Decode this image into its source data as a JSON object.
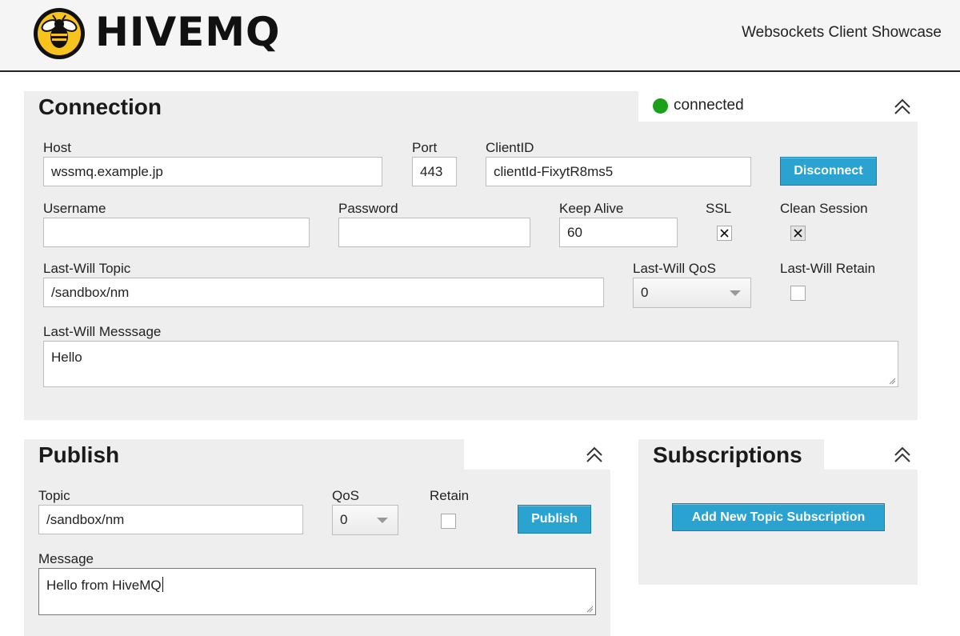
{
  "header": {
    "logo_text": "HIVEMQ",
    "showcase_title": "Websockets Client Showcase"
  },
  "connection": {
    "title": "Connection",
    "status": {
      "text": "connected",
      "color": "#1aa01a"
    },
    "host": {
      "label": "Host",
      "value": "wssmq.example.jp"
    },
    "port": {
      "label": "Port",
      "value": "443"
    },
    "client_id": {
      "label": "ClientID",
      "value": "clientId-FixytR8ms5"
    },
    "disconnect_label": "Disconnect",
    "username": {
      "label": "Username",
      "value": ""
    },
    "password": {
      "label": "Password",
      "value": ""
    },
    "keep_alive": {
      "label": "Keep Alive",
      "value": "60"
    },
    "ssl": {
      "label": "SSL",
      "checked": true
    },
    "clean_session": {
      "label": "Clean Session",
      "checked": true
    },
    "lw_topic": {
      "label": "Last-Will Topic",
      "value": "/sandbox/nm"
    },
    "lw_qos": {
      "label": "Last-Will QoS",
      "value": "0"
    },
    "lw_retain": {
      "label": "Last-Will Retain",
      "checked": false
    },
    "lw_message": {
      "label": "Last-Will Messsage",
      "value": "Hello"
    }
  },
  "publish": {
    "title": "Publish",
    "topic": {
      "label": "Topic",
      "value": "/sandbox/nm"
    },
    "qos": {
      "label": "QoS",
      "value": "0"
    },
    "retain": {
      "label": "Retain",
      "checked": false
    },
    "publish_label": "Publish",
    "message": {
      "label": "Message",
      "value": "Hello from HiveMQ"
    }
  },
  "subscriptions": {
    "title": "Subscriptions",
    "add_label": "Add New Topic Subscription"
  },
  "colors": {
    "accent": "#2aa3d0",
    "panel_bg": "#eeeeee",
    "logo_yellow": "#f7c31c"
  },
  "icons": {
    "logo": "bee-icon",
    "collapse": "double-chevron-up-icon",
    "checkmark": "x-mark-icon"
  }
}
